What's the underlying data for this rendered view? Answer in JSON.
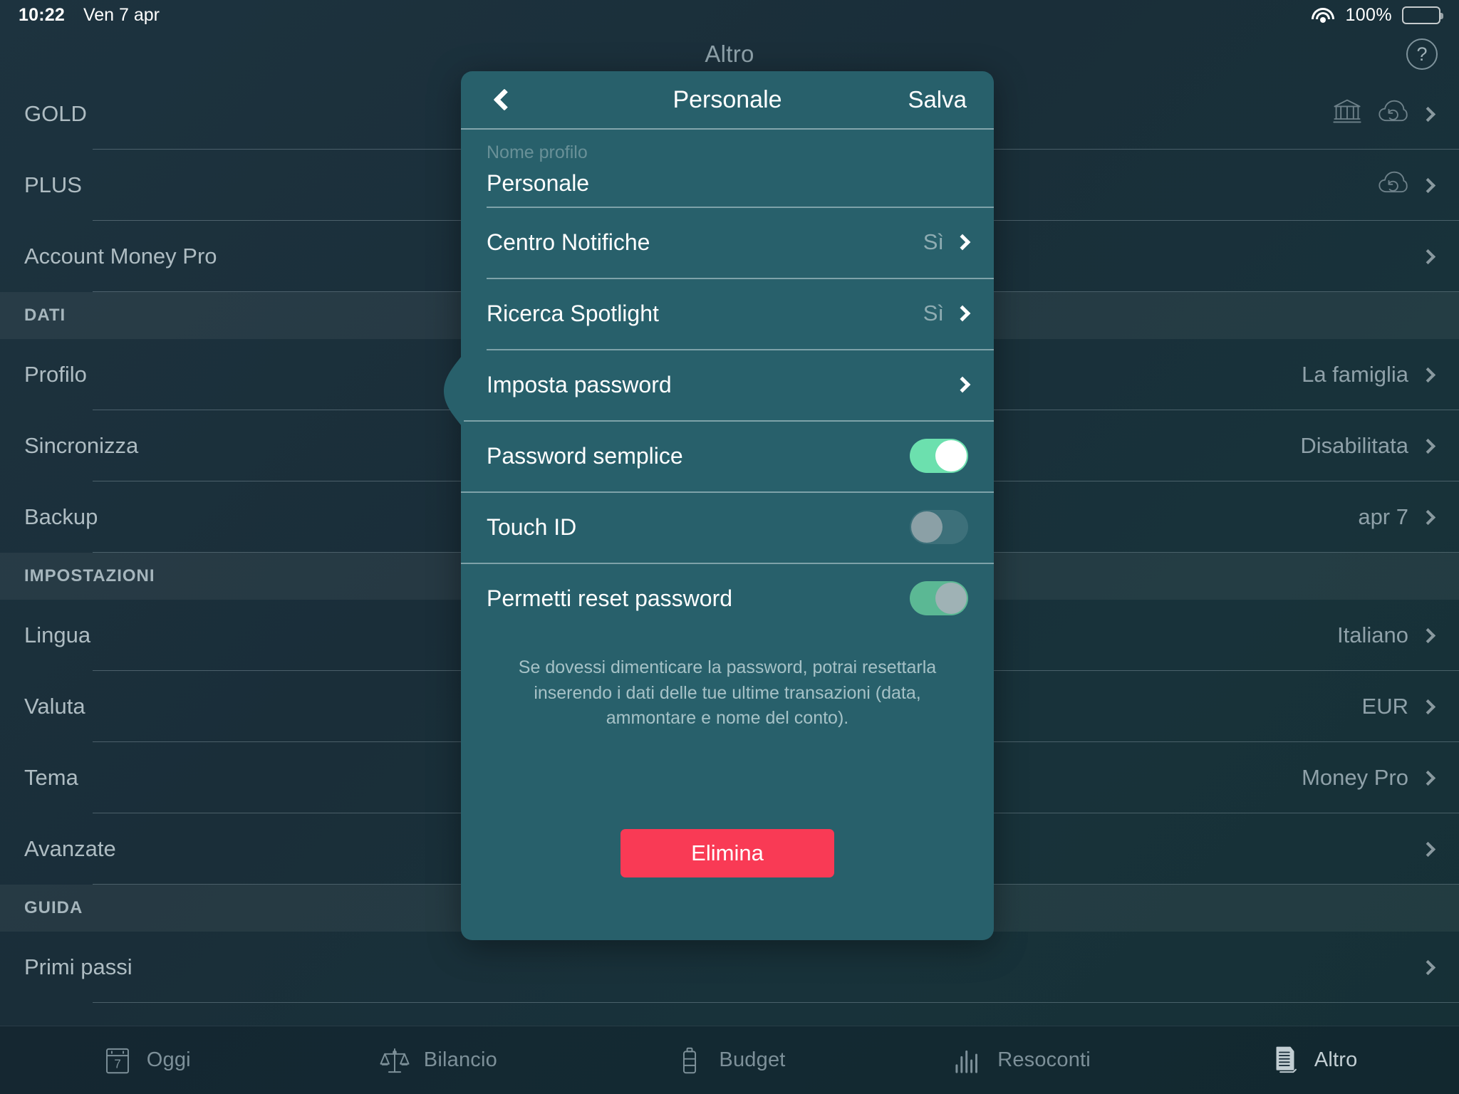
{
  "status_bar": {
    "time": "10:22",
    "date": "Ven 7 apr",
    "battery_percent": "100%",
    "wifi_icon": "wifi-icon",
    "battery_icon": "battery-icon"
  },
  "header": {
    "title": "Altro",
    "help_label": "?"
  },
  "background_list": {
    "rows": [
      {
        "type": "item",
        "label": "GOLD",
        "value": "",
        "icons": [
          "bank-icon",
          "cloud-sync-icon"
        ],
        "chevron": true
      },
      {
        "type": "item",
        "label": "PLUS",
        "value": "",
        "icons": [
          "cloud-sync-icon"
        ],
        "chevron": true
      },
      {
        "type": "item",
        "label": "Account Money Pro",
        "value": "",
        "icons": [],
        "chevron": true
      },
      {
        "type": "section",
        "label": "DATI"
      },
      {
        "type": "item",
        "label": "Profilo",
        "value": "La famiglia",
        "icons": [],
        "chevron": true
      },
      {
        "type": "item",
        "label": "Sincronizza",
        "value": "Disabilitata",
        "icons": [],
        "chevron": true
      },
      {
        "type": "item",
        "label": "Backup",
        "value": "apr 7",
        "icons": [],
        "chevron": true
      },
      {
        "type": "section",
        "label": "IMPOSTAZIONI"
      },
      {
        "type": "item",
        "label": "Lingua",
        "value": "Italiano",
        "icons": [],
        "chevron": true
      },
      {
        "type": "item",
        "label": "Valuta",
        "value": "EUR",
        "icons": [],
        "chevron": true
      },
      {
        "type": "item",
        "label": "Tema",
        "value": "Money Pro",
        "icons": [],
        "chevron": true
      },
      {
        "type": "item",
        "label": "Avanzate",
        "value": "",
        "icons": [],
        "chevron": true
      },
      {
        "type": "section",
        "label": "GUIDA"
      },
      {
        "type": "item",
        "label": "Primi passi",
        "value": "",
        "icons": [],
        "chevron": true
      }
    ]
  },
  "tabbar": {
    "tabs": [
      {
        "label": "Oggi",
        "icon": "calendar-icon",
        "active": false
      },
      {
        "label": "Bilancio",
        "icon": "scales-icon",
        "active": false
      },
      {
        "label": "Budget",
        "icon": "battery-budget-icon",
        "active": false
      },
      {
        "label": "Resoconti",
        "icon": "bar-chart-icon",
        "active": false
      },
      {
        "label": "Altro",
        "icon": "documents-icon",
        "active": true
      }
    ]
  },
  "popover": {
    "back_label": "back-chevron",
    "title": "Personale",
    "save_label": "Salva",
    "name_field": {
      "caption": "Nome profilo",
      "value": "Personale",
      "placeholder": "Nome profilo"
    },
    "rows": [
      {
        "label": "Centro Notifiche",
        "value": "Sì",
        "control": "chevron"
      },
      {
        "label": "Ricerca Spotlight",
        "value": "Sì",
        "control": "chevron"
      },
      {
        "label": "Imposta password",
        "value": "",
        "control": "chevron"
      },
      {
        "label": "Password semplice",
        "value": "",
        "control": "toggle",
        "toggle_state": "on"
      },
      {
        "label": "Touch ID",
        "value": "",
        "control": "toggle",
        "toggle_state": "off"
      },
      {
        "label": "Permetti reset password",
        "value": "",
        "control": "toggle",
        "toggle_state": "on-dim"
      }
    ],
    "footer_note": "Se dovessi dimenticare la password, potrai resettarla inserendo i dati delle tue ultime transazioni (data, ammontare e nome del conto).",
    "delete_label": "Elimina"
  },
  "colors": {
    "app_background": "#1b2f3b",
    "popover_background": "#28606b",
    "accent_green": "#6ce0ae",
    "accent_green_dim": "#5bb894",
    "destructive_red": "#f93a55",
    "text_primary": "#ffffff",
    "text_muted": "#8fa1a9"
  }
}
